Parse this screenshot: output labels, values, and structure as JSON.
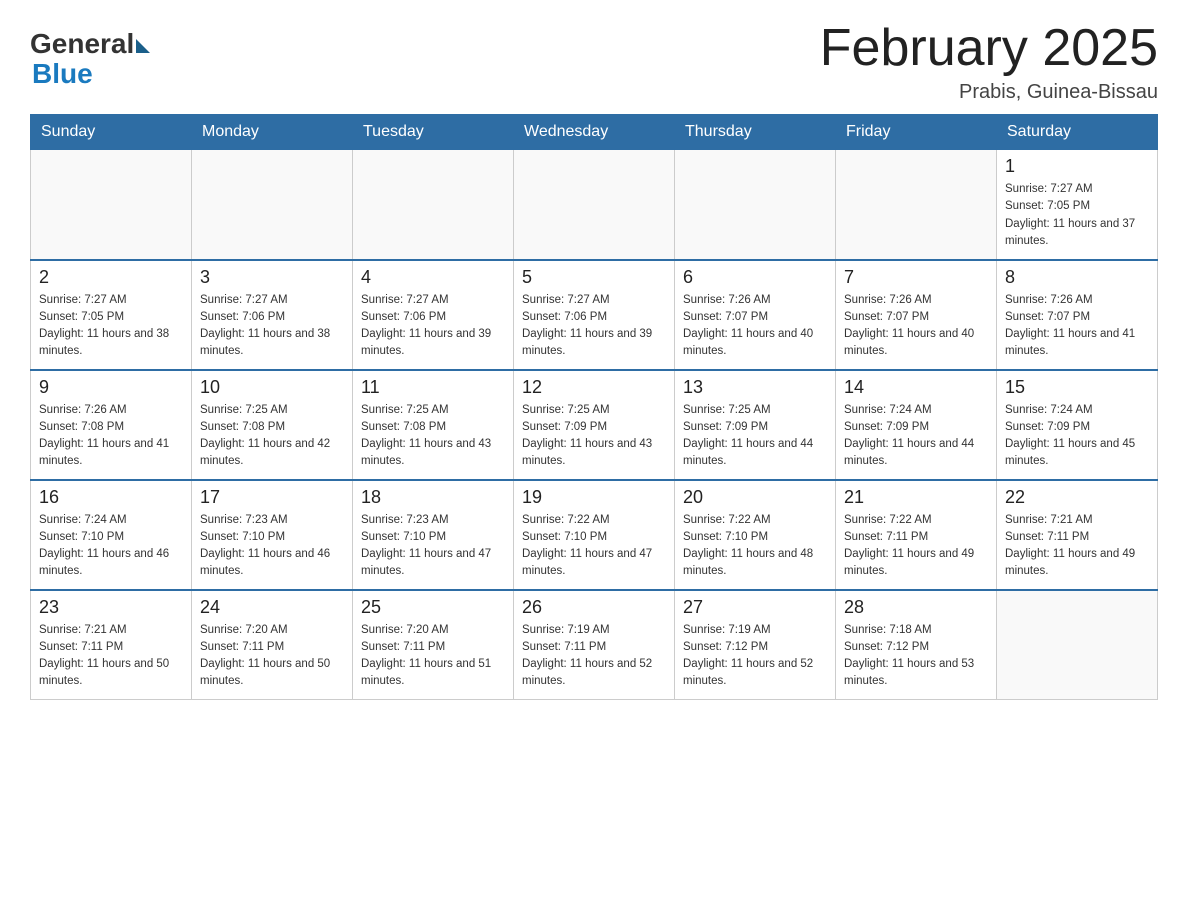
{
  "header": {
    "logo_general": "General",
    "logo_blue": "Blue",
    "title": "February 2025",
    "subtitle": "Prabis, Guinea-Bissau"
  },
  "days_of_week": [
    "Sunday",
    "Monday",
    "Tuesday",
    "Wednesday",
    "Thursday",
    "Friday",
    "Saturday"
  ],
  "weeks": [
    [
      {
        "day": "",
        "sunrise": "",
        "sunset": "",
        "daylight": ""
      },
      {
        "day": "",
        "sunrise": "",
        "sunset": "",
        "daylight": ""
      },
      {
        "day": "",
        "sunrise": "",
        "sunset": "",
        "daylight": ""
      },
      {
        "day": "",
        "sunrise": "",
        "sunset": "",
        "daylight": ""
      },
      {
        "day": "",
        "sunrise": "",
        "sunset": "",
        "daylight": ""
      },
      {
        "day": "",
        "sunrise": "",
        "sunset": "",
        "daylight": ""
      },
      {
        "day": "1",
        "sunrise": "Sunrise: 7:27 AM",
        "sunset": "Sunset: 7:05 PM",
        "daylight": "Daylight: 11 hours and 37 minutes."
      }
    ],
    [
      {
        "day": "2",
        "sunrise": "Sunrise: 7:27 AM",
        "sunset": "Sunset: 7:05 PM",
        "daylight": "Daylight: 11 hours and 38 minutes."
      },
      {
        "day": "3",
        "sunrise": "Sunrise: 7:27 AM",
        "sunset": "Sunset: 7:06 PM",
        "daylight": "Daylight: 11 hours and 38 minutes."
      },
      {
        "day": "4",
        "sunrise": "Sunrise: 7:27 AM",
        "sunset": "Sunset: 7:06 PM",
        "daylight": "Daylight: 11 hours and 39 minutes."
      },
      {
        "day": "5",
        "sunrise": "Sunrise: 7:27 AM",
        "sunset": "Sunset: 7:06 PM",
        "daylight": "Daylight: 11 hours and 39 minutes."
      },
      {
        "day": "6",
        "sunrise": "Sunrise: 7:26 AM",
        "sunset": "Sunset: 7:07 PM",
        "daylight": "Daylight: 11 hours and 40 minutes."
      },
      {
        "day": "7",
        "sunrise": "Sunrise: 7:26 AM",
        "sunset": "Sunset: 7:07 PM",
        "daylight": "Daylight: 11 hours and 40 minutes."
      },
      {
        "day": "8",
        "sunrise": "Sunrise: 7:26 AM",
        "sunset": "Sunset: 7:07 PM",
        "daylight": "Daylight: 11 hours and 41 minutes."
      }
    ],
    [
      {
        "day": "9",
        "sunrise": "Sunrise: 7:26 AM",
        "sunset": "Sunset: 7:08 PM",
        "daylight": "Daylight: 11 hours and 41 minutes."
      },
      {
        "day": "10",
        "sunrise": "Sunrise: 7:25 AM",
        "sunset": "Sunset: 7:08 PM",
        "daylight": "Daylight: 11 hours and 42 minutes."
      },
      {
        "day": "11",
        "sunrise": "Sunrise: 7:25 AM",
        "sunset": "Sunset: 7:08 PM",
        "daylight": "Daylight: 11 hours and 43 minutes."
      },
      {
        "day": "12",
        "sunrise": "Sunrise: 7:25 AM",
        "sunset": "Sunset: 7:09 PM",
        "daylight": "Daylight: 11 hours and 43 minutes."
      },
      {
        "day": "13",
        "sunrise": "Sunrise: 7:25 AM",
        "sunset": "Sunset: 7:09 PM",
        "daylight": "Daylight: 11 hours and 44 minutes."
      },
      {
        "day": "14",
        "sunrise": "Sunrise: 7:24 AM",
        "sunset": "Sunset: 7:09 PM",
        "daylight": "Daylight: 11 hours and 44 minutes."
      },
      {
        "day": "15",
        "sunrise": "Sunrise: 7:24 AM",
        "sunset": "Sunset: 7:09 PM",
        "daylight": "Daylight: 11 hours and 45 minutes."
      }
    ],
    [
      {
        "day": "16",
        "sunrise": "Sunrise: 7:24 AM",
        "sunset": "Sunset: 7:10 PM",
        "daylight": "Daylight: 11 hours and 46 minutes."
      },
      {
        "day": "17",
        "sunrise": "Sunrise: 7:23 AM",
        "sunset": "Sunset: 7:10 PM",
        "daylight": "Daylight: 11 hours and 46 minutes."
      },
      {
        "day": "18",
        "sunrise": "Sunrise: 7:23 AM",
        "sunset": "Sunset: 7:10 PM",
        "daylight": "Daylight: 11 hours and 47 minutes."
      },
      {
        "day": "19",
        "sunrise": "Sunrise: 7:22 AM",
        "sunset": "Sunset: 7:10 PM",
        "daylight": "Daylight: 11 hours and 47 minutes."
      },
      {
        "day": "20",
        "sunrise": "Sunrise: 7:22 AM",
        "sunset": "Sunset: 7:10 PM",
        "daylight": "Daylight: 11 hours and 48 minutes."
      },
      {
        "day": "21",
        "sunrise": "Sunrise: 7:22 AM",
        "sunset": "Sunset: 7:11 PM",
        "daylight": "Daylight: 11 hours and 49 minutes."
      },
      {
        "day": "22",
        "sunrise": "Sunrise: 7:21 AM",
        "sunset": "Sunset: 7:11 PM",
        "daylight": "Daylight: 11 hours and 49 minutes."
      }
    ],
    [
      {
        "day": "23",
        "sunrise": "Sunrise: 7:21 AM",
        "sunset": "Sunset: 7:11 PM",
        "daylight": "Daylight: 11 hours and 50 minutes."
      },
      {
        "day": "24",
        "sunrise": "Sunrise: 7:20 AM",
        "sunset": "Sunset: 7:11 PM",
        "daylight": "Daylight: 11 hours and 50 minutes."
      },
      {
        "day": "25",
        "sunrise": "Sunrise: 7:20 AM",
        "sunset": "Sunset: 7:11 PM",
        "daylight": "Daylight: 11 hours and 51 minutes."
      },
      {
        "day": "26",
        "sunrise": "Sunrise: 7:19 AM",
        "sunset": "Sunset: 7:11 PM",
        "daylight": "Daylight: 11 hours and 52 minutes."
      },
      {
        "day": "27",
        "sunrise": "Sunrise: 7:19 AM",
        "sunset": "Sunset: 7:12 PM",
        "daylight": "Daylight: 11 hours and 52 minutes."
      },
      {
        "day": "28",
        "sunrise": "Sunrise: 7:18 AM",
        "sunset": "Sunset: 7:12 PM",
        "daylight": "Daylight: 11 hours and 53 minutes."
      },
      {
        "day": "",
        "sunrise": "",
        "sunset": "",
        "daylight": ""
      }
    ]
  ]
}
